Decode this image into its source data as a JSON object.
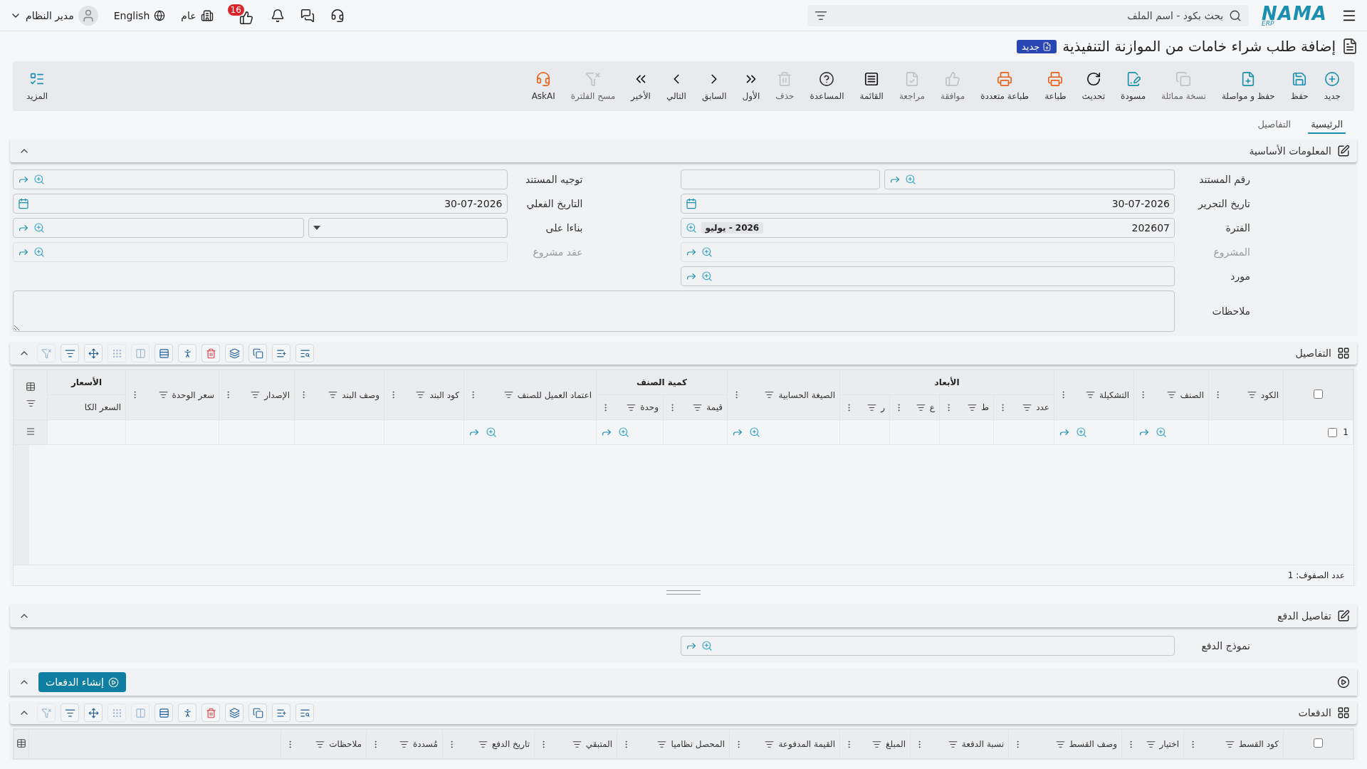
{
  "topbar": {
    "logo": "NAMA",
    "logo_sub": "ERP",
    "search_placeholder": "بحث بكود - اسم الملف",
    "branch": "عام",
    "notification_count": "16",
    "language": "English",
    "user": "مدير النظام"
  },
  "page": {
    "title": "إضافة طلب شراء خامات من الموازنة التنفيذية",
    "badge": "جديد"
  },
  "toolbar": [
    {
      "kind": "new",
      "label": "جديد",
      "disabled": false
    },
    {
      "kind": "save",
      "label": "حفظ",
      "disabled": false
    },
    {
      "kind": "save-continue",
      "label": "حفظ و مواصلة",
      "disabled": false
    },
    {
      "kind": "duplicate",
      "label": "نسخة مماثلة",
      "disabled": true
    },
    {
      "kind": "draft",
      "label": "مسودة",
      "disabled": false
    },
    {
      "kind": "refresh",
      "label": "تحديث",
      "disabled": false
    },
    {
      "kind": "print",
      "label": "طباعة",
      "disabled": false
    },
    {
      "kind": "multi-print",
      "label": "طباعة متعددة",
      "disabled": false
    },
    {
      "kind": "approve",
      "label": "موافقة",
      "disabled": true
    },
    {
      "kind": "review",
      "label": "مراجعة",
      "disabled": true
    },
    {
      "kind": "list",
      "label": "القائمة",
      "disabled": false
    },
    {
      "kind": "help",
      "label": "المساعدة",
      "disabled": false
    },
    {
      "kind": "delete",
      "label": "حذف",
      "disabled": true
    },
    {
      "kind": "first",
      "label": "الأول",
      "disabled": false
    },
    {
      "kind": "previous",
      "label": "السابق",
      "disabled": false
    },
    {
      "kind": "next",
      "label": "التالي",
      "disabled": false
    },
    {
      "kind": "last",
      "label": "الأخير",
      "disabled": false
    },
    {
      "kind": "clear-filter",
      "label": "مسح الفلترة",
      "disabled": true
    },
    {
      "kind": "ai",
      "label": "AskAI",
      "disabled": false
    }
  ],
  "more_button": {
    "label": "المزيد"
  },
  "tabs": [
    {
      "label": "الرئيسية",
      "selected": true
    },
    {
      "label": "التفاصيل",
      "selected": false
    }
  ],
  "basic_info": {
    "title": "المعلومات الأساسية",
    "expanded": true,
    "rows": [
      [
        {
          "kind": "lookup-extra",
          "label": "رقم المستند",
          "disabled": false
        },
        {
          "kind": "lookup",
          "label": "توجيه المستند",
          "disabled": false
        }
      ],
      [
        {
          "kind": "date",
          "label": "تاريخ التحرير",
          "value": "30-07-2026",
          "disabled": false
        },
        {
          "kind": "date",
          "label": "التاريخ الفعلي",
          "value": "30-07-2026",
          "disabled": false
        }
      ],
      [
        {
          "kind": "period",
          "label": "الفترة",
          "value": "202607",
          "tag": "2026 - يوليو",
          "disabled": false
        },
        {
          "kind": "select-lookup",
          "label": "بناءا على",
          "disabled": false
        }
      ],
      [
        {
          "kind": "lookup",
          "label": "المشروع",
          "disabled": true
        },
        {
          "kind": "lookup",
          "label": "عقد مشروع",
          "disabled": true
        }
      ],
      [
        {
          "kind": "lookup",
          "label": "مورد",
          "disabled": false
        }
      ]
    ],
    "notes": {
      "label": "ملاحظات"
    }
  },
  "details": {
    "title": "التفاصيل",
    "expanded": true,
    "tools": [
      {
        "kind": "search-list",
        "disabled": false
      },
      {
        "kind": "add-row",
        "disabled": false
      },
      {
        "kind": "copy",
        "disabled": false
      },
      {
        "kind": "layers",
        "disabled": false
      },
      {
        "kind": "delete",
        "disabled": false
      },
      {
        "kind": "walker",
        "disabled": false
      },
      {
        "kind": "rows",
        "disabled": false
      },
      {
        "kind": "columns",
        "disabled": true
      },
      {
        "kind": "grip",
        "disabled": true
      },
      {
        "kind": "move",
        "disabled": false
      },
      {
        "kind": "filter",
        "disabled": false
      },
      {
        "kind": "clear-filter",
        "disabled": true
      }
    ],
    "columns": [
      {
        "kind": "single",
        "label": "الكود"
      },
      {
        "kind": "single",
        "label": "الصنف",
        "lookup": true
      },
      {
        "kind": "single",
        "label": "التشكيلة",
        "lookup": true
      },
      {
        "kind": "group",
        "label": "الأبعاد",
        "children": [
          {
            "label": "عدد"
          },
          {
            "label": "ط"
          },
          {
            "label": "ع"
          },
          {
            "label": "ر"
          }
        ]
      },
      {
        "kind": "single",
        "label": "الصيغة الحسابية",
        "lookup": true
      },
      {
        "kind": "group",
        "label": "كمية الصنف",
        "children": [
          {
            "label": "قيمة"
          },
          {
            "label": "وحدة",
            "lookup": true
          }
        ]
      },
      {
        "kind": "single",
        "label": "اعتماد العميل للصنف",
        "lookup": true
      },
      {
        "kind": "single",
        "label": "كود البند"
      },
      {
        "kind": "single",
        "label": "وصف البند"
      },
      {
        "kind": "single",
        "label": "الإصدار"
      },
      {
        "kind": "single",
        "label": "سعر الوحدة"
      },
      {
        "kind": "group",
        "label": "الأسعار",
        "children": [
          {
            "label": "السعر الكا"
          }
        ]
      }
    ],
    "select_all": {
      "checked": false
    },
    "rows": [
      {
        "number": "1",
        "selected": false
      }
    ],
    "footer": "عدد الصفوف: 1"
  },
  "payment_details": {
    "title": "تفاصيل الدفع",
    "expanded": true,
    "field": {
      "kind": "lookup",
      "label": "نموذج الدفع",
      "disabled": false
    }
  },
  "create_payments": {
    "label": "إنشاء الدفعات",
    "expanded": true
  },
  "payments": {
    "title": "الدفعات",
    "expanded": true,
    "tools": [
      {
        "kind": "search-list",
        "disabled": false
      },
      {
        "kind": "add-row",
        "disabled": false
      },
      {
        "kind": "copy",
        "disabled": false
      },
      {
        "kind": "layers",
        "disabled": false
      },
      {
        "kind": "delete",
        "disabled": false
      },
      {
        "kind": "walker",
        "disabled": false
      },
      {
        "kind": "rows",
        "disabled": false
      },
      {
        "kind": "columns",
        "disabled": true
      },
      {
        "kind": "grip",
        "disabled": true
      },
      {
        "kind": "move",
        "disabled": false
      },
      {
        "kind": "filter",
        "disabled": false
      },
      {
        "kind": "clear-filter",
        "disabled": true
      }
    ],
    "select_all": {
      "checked": false
    },
    "columns": [
      {
        "label": "كود القسط"
      },
      {
        "label": "اختيار"
      },
      {
        "label": "وصف القسط"
      },
      {
        "label": "نسبة الدفعة"
      },
      {
        "label": "المبلغ"
      },
      {
        "label": "القيمة المدفوعة"
      },
      {
        "label": "المحصل نظاميا"
      },
      {
        "label": "المتبقي"
      },
      {
        "label": "تاريخ الدفع"
      },
      {
        "label": "مُسددة"
      },
      {
        "label": "ملاحظات"
      }
    ]
  }
}
